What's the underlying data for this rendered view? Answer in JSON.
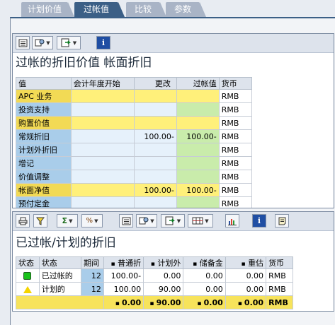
{
  "tabs": [
    {
      "label": "计划价值",
      "active": false
    },
    {
      "label": "过帐值",
      "active": true
    },
    {
      "label": "比较",
      "active": false
    },
    {
      "label": "参数",
      "active": false
    }
  ],
  "panel1": {
    "title": "过帐的折旧价值 帐面折旧",
    "toolbar_icons": [
      "details-icon",
      "change-layout-icon",
      "export-icon",
      "info-icon"
    ],
    "columns": [
      "值",
      "会计年度开始",
      "更改",
      "过帐值",
      "货币"
    ],
    "rows": [
      {
        "label": "APC 业务",
        "fy_start": "",
        "change": "",
        "posted": "",
        "currency": "RMB",
        "style": "yellow"
      },
      {
        "label": "投资支持",
        "fy_start": "",
        "change": "",
        "posted": "",
        "currency": "RMB",
        "style": "blue"
      },
      {
        "label": "购置价值",
        "fy_start": "",
        "change": "",
        "posted": "",
        "currency": "RMB",
        "style": "yellow"
      },
      {
        "label": "常规折旧",
        "fy_start": "",
        "change": "100.00-",
        "posted": "100.00-",
        "currency": "RMB",
        "style": "blue"
      },
      {
        "label": "计划外折旧",
        "fy_start": "",
        "change": "",
        "posted": "",
        "currency": "RMB",
        "style": "blue"
      },
      {
        "label": "增记",
        "fy_start": "",
        "change": "",
        "posted": "",
        "currency": "RMB",
        "style": "blue"
      },
      {
        "label": "价值调整",
        "fy_start": "",
        "change": "",
        "posted": "",
        "currency": "RMB",
        "style": "blue"
      },
      {
        "label": "帐面净值",
        "fy_start": "",
        "change": "100.00-",
        "posted": "100.00-",
        "currency": "RMB",
        "style": "yellow"
      },
      {
        "label": "预付定金",
        "fy_start": "",
        "change": "",
        "posted": "",
        "currency": "RMB",
        "style": "blue"
      }
    ]
  },
  "panel2": {
    "title": "已过帐/计划的折旧",
    "toolbar_icons": [
      "print-icon",
      "filter-icon",
      "sum-icon",
      "subtotal-icon",
      "details-icon",
      "change-layout-icon",
      "export-icon",
      "grid-layout-icon",
      "graphic-icon",
      "info-icon",
      "note-icon"
    ],
    "columns": [
      "状态",
      "状态",
      "期间",
      "普通折",
      "计划外",
      "储备金",
      "重估",
      "货币"
    ],
    "rows": [
      {
        "status_icon": "green-square-icon",
        "status": "已过帐的",
        "period": "12",
        "ordinary": "100.00-",
        "unplanned": "0.00",
        "reserve": "0.00",
        "revaluation": "0.00",
        "currency": "RMB"
      },
      {
        "status_icon": "yellow-triangle-icon",
        "status": "计划的",
        "period": "12",
        "ordinary": "100.00",
        "unplanned": "90.00",
        "reserve": "0.00",
        "revaluation": "0.00",
        "currency": "RMB"
      }
    ],
    "total": {
      "ordinary": "0.00",
      "unplanned": "90.00",
      "reserve": "0.00",
      "revaluation": "0.00",
      "currency": "RMB"
    }
  }
}
